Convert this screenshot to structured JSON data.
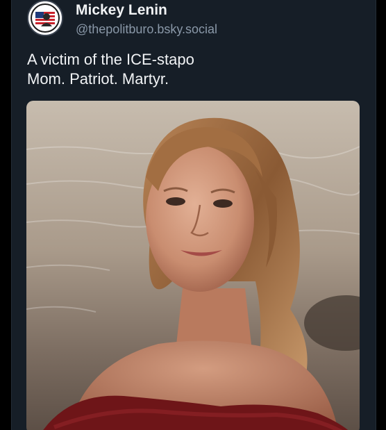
{
  "post": {
    "author": {
      "display_name": "Mickey Lenin",
      "handle": "@thepolitburo.bsky.social",
      "avatar_icon": "politburo-badge-icon"
    },
    "text_lines": [
      "A victim of the ICE-stapo",
      "Mom. Patriot. Martyr."
    ],
    "image": {
      "subject": "portrait photo"
    }
  },
  "colors": {
    "background": "#161e27",
    "text_primary": "#f1f3f5",
    "text_secondary": "#8a98a8"
  }
}
